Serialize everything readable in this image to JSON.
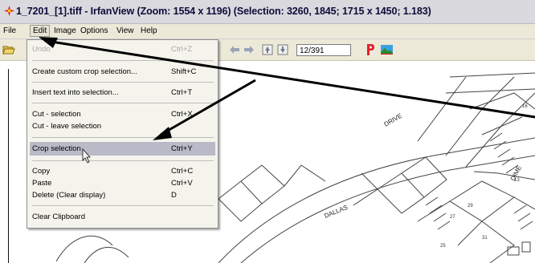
{
  "window": {
    "title": "1_7201_[1].tiff - IrfanView (Zoom: 1554 x 1196) (Selection: 3260, 1845; 1715 x 1450; 1.183)"
  },
  "menubar": {
    "items": [
      {
        "label": "File"
      },
      {
        "label": "Edit"
      },
      {
        "label": "Image"
      },
      {
        "label": "Options"
      },
      {
        "label": "View"
      },
      {
        "label": "Help"
      }
    ]
  },
  "toolbar": {
    "page_field": "12/391",
    "icons": [
      "open-icon",
      "back-arrow-icon",
      "forward-arrow-icon",
      "page-up-icon",
      "page-down-icon",
      "paint-icon",
      "photo-icon"
    ]
  },
  "edit_menu": {
    "items": [
      {
        "label": "Undo",
        "shortcut": "Ctrl+Z"
      },
      {
        "label": "Create custom crop selection...",
        "shortcut": "Shift+C"
      },
      {
        "label": "Insert text into selection...",
        "shortcut": "Ctrl+T"
      },
      {
        "label": "Cut - selection",
        "shortcut": "Ctrl+X"
      },
      {
        "label": "Cut - leave selection",
        "shortcut": ""
      },
      {
        "label": "Crop selection",
        "shortcut": "Ctrl+Y"
      },
      {
        "label": "Copy",
        "shortcut": "Ctrl+C"
      },
      {
        "label": "Paste",
        "shortcut": "Ctrl+V"
      },
      {
        "label": "Delete (Clear display)",
        "shortcut": "D"
      },
      {
        "label": "Clear Clipboard",
        "shortcut": ""
      }
    ]
  },
  "map": {
    "labels": [
      "DRIVE",
      "DALLAS",
      "DIME"
    ]
  },
  "colors": {
    "menu_highlight": "#b9b9c8",
    "annotation_arrow": "#000000",
    "p_icon": "#e0202a"
  }
}
